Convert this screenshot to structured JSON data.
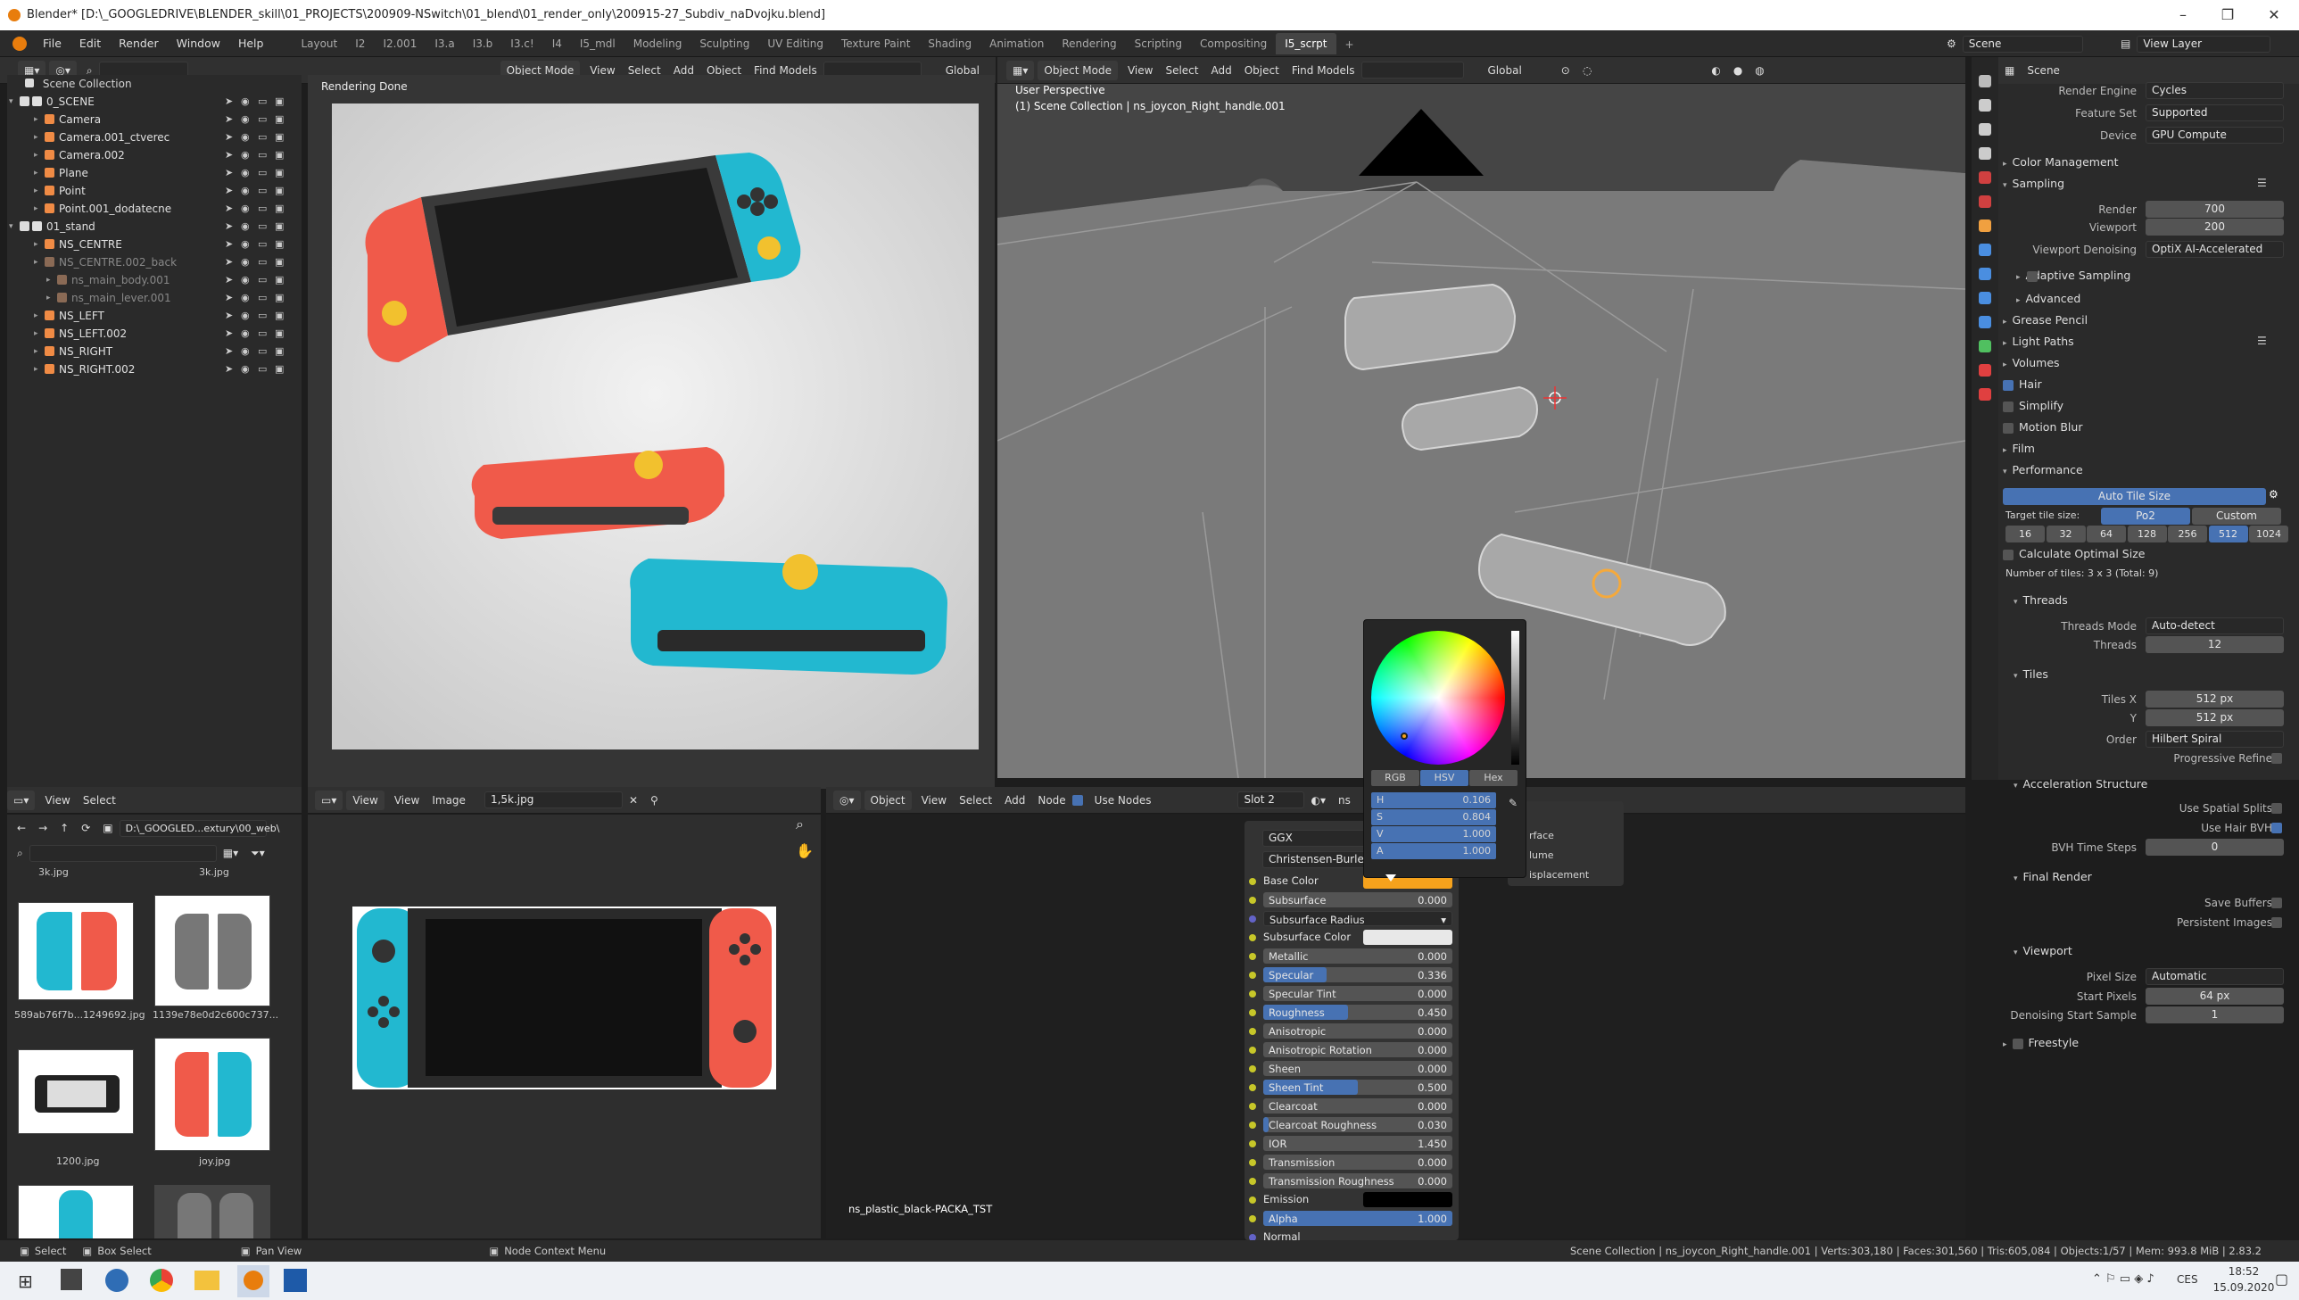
{
  "window": {
    "title": "Blender* [D:\\_GOOGLEDRIVE\\BLENDER_skill\\01_PROJECTS\\200909-NSwitch\\01_blend\\01_render_only\\200915-27_Subdiv_naDvojku.blend]",
    "minimize": "–",
    "maximize": "❐",
    "close": "✕"
  },
  "menu": [
    "File",
    "Edit",
    "Render",
    "Window",
    "Help"
  ],
  "workspaces": [
    "Layout",
    "I2",
    "I2.001",
    "I3.a",
    "I3.b",
    "I3.c!",
    "I4",
    "I5_mdl",
    "Modeling",
    "Sculpting",
    "UV Editing",
    "Texture Paint",
    "Shading",
    "Animation",
    "Rendering",
    "Scripting",
    "Compositing",
    "I5_scrpt"
  ],
  "workspace_add": "+",
  "scene": {
    "name": "Scene",
    "view_layer": "View Layer"
  },
  "outliner": {
    "title": "Scene Collection",
    "rows": [
      {
        "label": "0_SCENE",
        "depth": 1,
        "kind": "collection"
      },
      {
        "label": "Camera",
        "depth": 2,
        "kind": "camera"
      },
      {
        "label": "Camera.001_ctverec",
        "depth": 2,
        "kind": "camera"
      },
      {
        "label": "Camera.002",
        "depth": 2,
        "kind": "camera"
      },
      {
        "label": "Plane",
        "depth": 2,
        "kind": "mesh"
      },
      {
        "label": "Point",
        "depth": 2,
        "kind": "light"
      },
      {
        "label": "Point.001_dodatecne",
        "depth": 2,
        "kind": "light"
      },
      {
        "label": "01_stand",
        "depth": 1,
        "kind": "collection"
      },
      {
        "label": "NS_CENTRE",
        "depth": 2,
        "kind": "empty"
      },
      {
        "label": "NS_CENTRE.002_back",
        "depth": 2,
        "kind": "empty-dim"
      },
      {
        "label": "ns_main_body.001",
        "depth": 3,
        "kind": "mesh-dim"
      },
      {
        "label": "ns_main_lever.001",
        "depth": 3,
        "kind": "mesh-dim"
      },
      {
        "label": "NS_LEFT",
        "depth": 2,
        "kind": "empty"
      },
      {
        "label": "NS_LEFT.002",
        "depth": 2,
        "kind": "empty"
      },
      {
        "label": "NS_RIGHT",
        "depth": 2,
        "kind": "empty"
      },
      {
        "label": "NS_RIGHT.002",
        "depth": 2,
        "kind": "empty"
      }
    ]
  },
  "render_view": {
    "status": "Rendering Done"
  },
  "left_header": {
    "mode": "Object Mode",
    "menus": [
      "View",
      "Select",
      "Add",
      "Object"
    ],
    "find": "Find Models",
    "orientation": "Global"
  },
  "viewport": {
    "mode": "Object Mode",
    "menus": [
      "View",
      "Select",
      "Add",
      "Object"
    ],
    "find": "Find Models",
    "orientation": "Global",
    "perspective": "User Perspective",
    "collection": "(1) Scene Collection | ns_joycon_Right_handle.001"
  },
  "properties": {
    "scene_label": "Scene",
    "render_engine_label": "Render Engine",
    "render_engine": "Cycles",
    "feature_set_label": "Feature Set",
    "feature_set": "Supported",
    "device_label": "Device",
    "device": "GPU Compute",
    "color_management": "Color Management",
    "sampling": "Sampling",
    "render_label": "Render",
    "render_samples": "700",
    "viewport_label": "Viewport",
    "viewport_samples": "200",
    "denoise_label": "Viewport Denoising",
    "denoise": "OptiX AI-Accelerated",
    "adaptive": "Adaptive Sampling",
    "advanced": "Advanced",
    "grease_pencil": "Grease Pencil",
    "light_paths": "Light Paths",
    "volumes": "Volumes",
    "hair": "Hair",
    "simplify": "Simplify",
    "motion_blur": "Motion Blur",
    "film": "Film",
    "performance": "Performance",
    "auto_tile": "Auto Tile Size",
    "target_tile_label": "Target tile size:",
    "pot2": "Po2",
    "custom": "Custom",
    "tile_sizes": [
      "16",
      "32",
      "64",
      "128",
      "256",
      "512",
      "1024"
    ],
    "calc_optimal": "Calculate Optimal Size",
    "num_tiles": "Number of tiles: 3 x 3 (Total: 9)",
    "threads": "Threads",
    "threads_mode_label": "Threads Mode",
    "threads_mode": "Auto-detect",
    "threads_label": "Threads",
    "threads_val": "12",
    "tiles": "Tiles",
    "tiles_x_label": "Tiles X",
    "tiles_x": "512 px",
    "tiles_y_label": "Y",
    "tiles_y": "512 px",
    "order_label": "Order",
    "order": "Hilbert Spiral",
    "progressive": "Progressive Refine",
    "accel": "Acceleration Structure",
    "spatial_splits": "Use Spatial Splits",
    "hair_bvh": "Use Hair BVH",
    "bvh_steps_label": "BVH Time Steps",
    "bvh_steps": "0",
    "final_render": "Final Render",
    "save_buffers": "Save Buffers",
    "persistent": "Persistent Images",
    "viewport_sect": "Viewport",
    "pixel_size_label": "Pixel Size",
    "pixel_size": "Automatic",
    "start_pixels_label": "Start Pixels",
    "start_pixels": "64 px",
    "denoise_start_label": "Denoising Start Sample",
    "denoise_start": "1",
    "freestyle": "Freestyle"
  },
  "file_browser": {
    "menus": [
      "View",
      "Select"
    ],
    "path": "D:\\_GOOGLED...extury\\00_web\\",
    "top_labels": [
      "3k.jpg",
      "3k.jpg"
    ],
    "files": [
      "589ab76f7b...1249692.jpg",
      "1139e78e0d2c600c737...",
      "1200.jpg",
      "joy.jpg"
    ]
  },
  "image_editor": {
    "menus": [
      "View",
      "View",
      "Image"
    ],
    "image": "1,5k.jpg"
  },
  "node_editor": {
    "mode": "Object",
    "menus": [
      "View",
      "Select",
      "Add",
      "Node"
    ],
    "use_nodes": "Use Nodes",
    "slot": "Slot 2",
    "material_prefix": "ns",
    "distribution": "GGX",
    "subsurface_method": "Christensen-Burley",
    "material_name": "ns_plastic_black-PACKA_TST",
    "output_sockets": [
      "rface",
      "lume",
      "isplacement"
    ],
    "inputs": [
      {
        "label": "Base Color",
        "value": "",
        "kind": "color",
        "color": "#f6a21c"
      },
      {
        "label": "Subsurface",
        "value": "0.000",
        "fill": 0
      },
      {
        "label": "Subsurface Radius",
        "value": "",
        "kind": "dropdown"
      },
      {
        "label": "Subsurface Color",
        "value": "",
        "kind": "color",
        "color": "#e8e8e8"
      },
      {
        "label": "Metallic",
        "value": "0.000",
        "fill": 0
      },
      {
        "label": "Specular",
        "value": "0.336",
        "fill": 0.336
      },
      {
        "label": "Specular Tint",
        "value": "0.000",
        "fill": 0
      },
      {
        "label": "Roughness",
        "value": "0.450",
        "fill": 0.45
      },
      {
        "label": "Anisotropic",
        "value": "0.000",
        "fill": 0
      },
      {
        "label": "Anisotropic Rotation",
        "value": "0.000",
        "fill": 0
      },
      {
        "label": "Sheen",
        "value": "0.000",
        "fill": 0
      },
      {
        "label": "Sheen Tint",
        "value": "0.500",
        "fill": 0.5
      },
      {
        "label": "Clearcoat",
        "value": "0.000",
        "fill": 0
      },
      {
        "label": "Clearcoat Roughness",
        "value": "0.030",
        "fill": 0.03
      },
      {
        "label": "IOR",
        "value": "1.450",
        "fill": 0
      },
      {
        "label": "Transmission",
        "value": "0.000",
        "fill": 0
      },
      {
        "label": "Transmission Roughness",
        "value": "0.000",
        "fill": 0
      },
      {
        "label": "Emission",
        "value": "",
        "kind": "color",
        "color": "#000000"
      },
      {
        "label": "Alpha",
        "value": "1.000",
        "fill": 1
      },
      {
        "label": "Normal",
        "value": "",
        "kind": "plain"
      }
    ]
  },
  "color_picker": {
    "modes": [
      "RGB",
      "HSV",
      "Hex"
    ],
    "active_mode": "HSV",
    "fields": [
      {
        "label": "H",
        "value": "0.106"
      },
      {
        "label": "S",
        "value": "0.804"
      },
      {
        "label": "V",
        "value": "1.000"
      },
      {
        "label": "A",
        "value": "1.000"
      }
    ]
  },
  "statusbar": {
    "select": "Select",
    "box_select": "Box Select",
    "pan_view": "Pan View",
    "node_context": "Node Context Menu",
    "stats": "Scene Collection | ns_joycon_Right_handle.001 | Verts:303,180 | Faces:301,560 | Tris:605,084 | Objects:1/57 | Mem: 993.8 MiB | 2.83.2"
  },
  "taskbar": {
    "lang": "CES",
    "time": "18:52",
    "date": "15.09.2020"
  },
  "colors": {
    "accent": "#4772b3",
    "orange": "#f6a21c",
    "joycon_red": "#f05a4a",
    "joycon_blue": "#22b8d0"
  }
}
